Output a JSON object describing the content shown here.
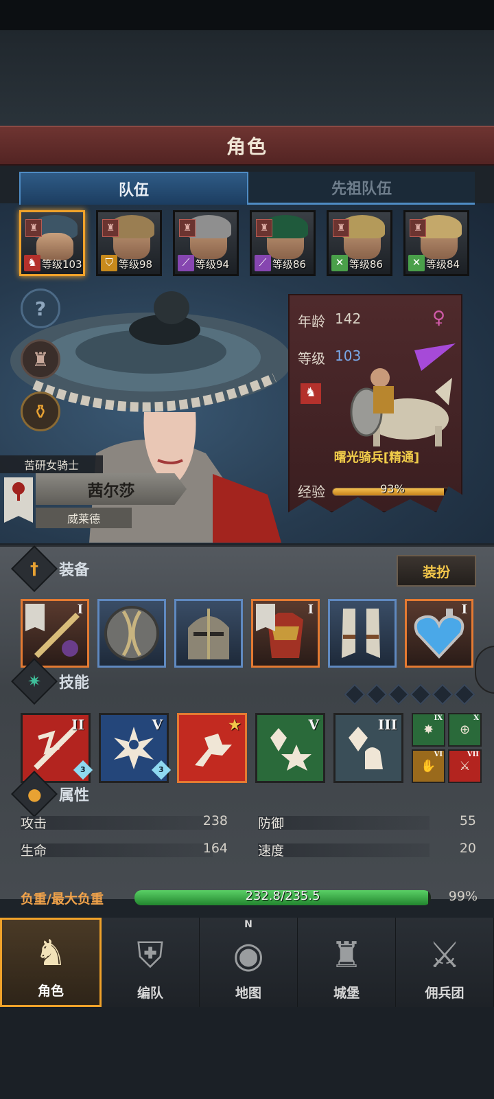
{
  "title": "角色",
  "tabs": [
    {
      "label": "队伍",
      "active": true
    },
    {
      "label": "先祖队伍",
      "active": false
    }
  ],
  "roster": [
    {
      "level_text": "等级103",
      "role_icon": "mounted-knight-icon",
      "role_color": "#b4312c",
      "hair": "#3d5566",
      "selected": true
    },
    {
      "level_text": "等级98",
      "role_icon": "shield-icon",
      "role_color": "#c88a1c",
      "hair": "#9a7e52",
      "selected": false
    },
    {
      "level_text": "等级94",
      "role_icon": "staff-icon",
      "role_color": "#8646b0",
      "hair": "#8f8f8f",
      "selected": false
    },
    {
      "level_text": "等级86",
      "role_icon": "staff-icon",
      "role_color": "#8646b0",
      "hair": "#1f5a3c",
      "selected": false
    },
    {
      "level_text": "等级86",
      "role_icon": "crossed-swords-icon",
      "role_color": "#4aa04a",
      "hair": "#b49a5a",
      "selected": false
    },
    {
      "level_text": "等级84",
      "role_icon": "crossed-swords-icon",
      "role_color": "#4aa04a",
      "hair": "#c4a86a",
      "selected": false
    }
  ],
  "hero": {
    "class_title": "苦研女骑士",
    "name": "茜尔莎",
    "origin": "威莱德"
  },
  "info": {
    "age_label": "年龄",
    "age": "142",
    "level_label": "等级",
    "level": "103",
    "gender_icon": "female-icon",
    "mount_name": "曙光骑兵[精通]",
    "exp_label": "经验",
    "exp_text": "93%",
    "exp_fraction": 0.93
  },
  "sections": {
    "equipment": "装备",
    "skills": "技能",
    "attributes": "属性",
    "dress_button": "装扮"
  },
  "equipment": [
    {
      "name": "lance-weapon",
      "rarity": "orange",
      "roman": "I"
    },
    {
      "name": "round-shield",
      "rarity": "blue",
      "roman": ""
    },
    {
      "name": "great-helm",
      "rarity": "blue",
      "roman": ""
    },
    {
      "name": "red-armor",
      "rarity": "orange",
      "roman": "I"
    },
    {
      "name": "steel-boots",
      "rarity": "blue",
      "roman": ""
    },
    {
      "name": "heart-amulet",
      "rarity": "orange",
      "roman": "I"
    }
  ],
  "skills": [
    {
      "name": "charge-skill",
      "roman": "II",
      "gem": "3",
      "bg": "#b3241f"
    },
    {
      "name": "holy-burst-skill",
      "roman": "V",
      "gem": "3",
      "bg": "#24467a"
    },
    {
      "name": "rush-skill",
      "roman": "★",
      "gem": "",
      "bg": "#c22a20"
    },
    {
      "name": "crystal-burst-skill",
      "roman": "V",
      "gem": "",
      "bg": "#2a6a3a"
    },
    {
      "name": "crystal-strike-skill",
      "roman": "III",
      "gem": "",
      "bg": "#3a4e58"
    }
  ],
  "mini_skills": [
    {
      "name": "burst-passive",
      "roman": "IX",
      "bg": "#2a6a3a"
    },
    {
      "name": "target-passive",
      "roman": "X",
      "bg": "#2a6a3a"
    },
    {
      "name": "guard-passive",
      "roman": "VI",
      "bg": "#9a6a1c"
    },
    {
      "name": "sword-passive",
      "roman": "VII",
      "bg": "#b3241f"
    }
  ],
  "stats": [
    {
      "label": "攻击",
      "value": "238"
    },
    {
      "label": "防御",
      "value": "55"
    },
    {
      "label": "生命",
      "value": "164"
    },
    {
      "label": "速度",
      "value": "20"
    }
  ],
  "load": {
    "label": "负重/最大负重",
    "text": "232.8/235.5",
    "percent": "99%",
    "fraction": 0.99
  },
  "nav": [
    {
      "label": "角色",
      "icon": "knight-icon",
      "active": true
    },
    {
      "label": "编队",
      "icon": "formation-icon",
      "active": false
    },
    {
      "label": "地图",
      "icon": "compass-map-icon",
      "compass_n": "N",
      "active": false
    },
    {
      "label": "城堡",
      "icon": "castle-icon",
      "active": false
    },
    {
      "label": "佣兵团",
      "icon": "mercenary-icon",
      "active": false
    }
  ]
}
